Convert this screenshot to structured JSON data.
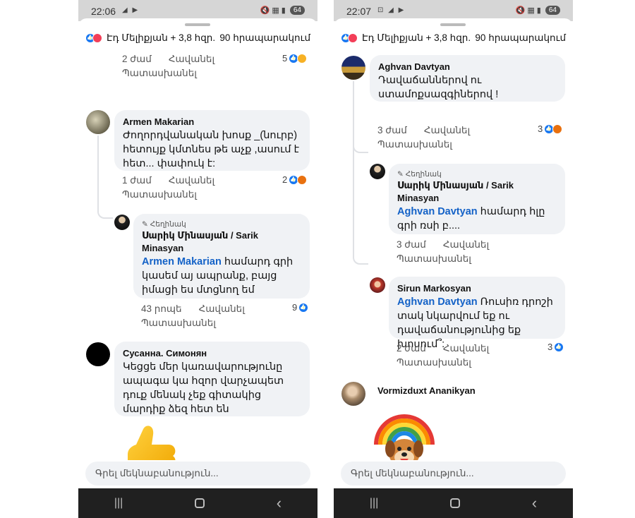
{
  "left": {
    "status": {
      "time": "22:06",
      "icons_left": "◢ ▶",
      "icons_right": "🔇 ▦ ▮",
      "battery": "64"
    },
    "header": {
      "names": "Էդ Մելիքյան + 3,8 հզր.",
      "shares": "90 հրապարակում"
    },
    "top_meta": {
      "time": "2 ժամ",
      "like": "Հավանել",
      "reply": "Պատասխանել",
      "count": "5"
    },
    "comments": [
      {
        "author": "Armen Makarian",
        "text": "Ժողորդվանական խոսք _(նուրբ) հետույք կմտնես թե աչք ,ասում է հետ... փափուկ է:",
        "time": "1 ժամ",
        "like": "Հավանել",
        "reply": "Պատասխանել",
        "count": "2"
      },
      {
        "badge": "✎ Հեղինակ",
        "author": "Սարիկ Մինասյան /  Sarik Minasyan",
        "mention": "Armen Makarian",
        "text": " համարդ գրի կասեմ այ ապրանք, բայց իմացի ես մտցնող եմ",
        "time": "43 րոպե",
        "like": "Հավանել",
        "reply": "Պատասխանել",
        "count": "9"
      },
      {
        "author": "Сусанна. Симонян",
        "text": "Կեցցե մեր կառավարությունը ապագա կա հզոր վարչապետ դուք մենակ չեք գիտակից մարդիք ձեզ հետ են"
      }
    ],
    "composer": {
      "placeholder": "Գրել մեկնաբանություն..."
    },
    "nav": {
      "recent": "|||",
      "back": "‹"
    }
  },
  "right": {
    "status": {
      "time": "22:07",
      "icons_left": "⊡ ◢ ▶",
      "icons_right": "🔇 ▦ ▮",
      "battery": "64"
    },
    "header": {
      "names": "Էդ Մելիքյան + 3,8 հզր.",
      "shares": "90 հրապարակում"
    },
    "comments": [
      {
        "author": "Aghvan Davtyan",
        "text": "Դավաճաններով ու ստամոքսազգիներով !",
        "time": "3 ժամ",
        "like": "Հավանել",
        "reply": "Պատասխանել",
        "count": "3"
      },
      {
        "badge": "✎ Հեղինակ",
        "author": "Սարիկ Մինասյան /  Sarik Minasyan",
        "mention": "Aghvan Davtyan",
        "text": " համարդ հլը գրի ռսի բ....",
        "time": "3 ժամ",
        "like": "Հավանել",
        "reply": "Պատասխանել"
      },
      {
        "author": "Sirun Markosyan",
        "mention": "Aghvan Davtyan",
        "text": " Ռուսիռ դրոշի տակ նկարվում եք ու դավաճանությունից եք խոսում՞:",
        "time": "2 ժամ",
        "like": "Հավանել",
        "reply": "Պատասխանել",
        "count": "3"
      },
      {
        "author": "Vormizduxt Ananikyan"
      }
    ],
    "composer": {
      "placeholder": "Գրել մեկնաբանություն..."
    },
    "nav": {
      "recent": "|||",
      "back": "‹"
    }
  },
  "colors": {
    "mention": "#1462c7",
    "bubble": "#f0f2f5",
    "like": "#1877f2"
  }
}
